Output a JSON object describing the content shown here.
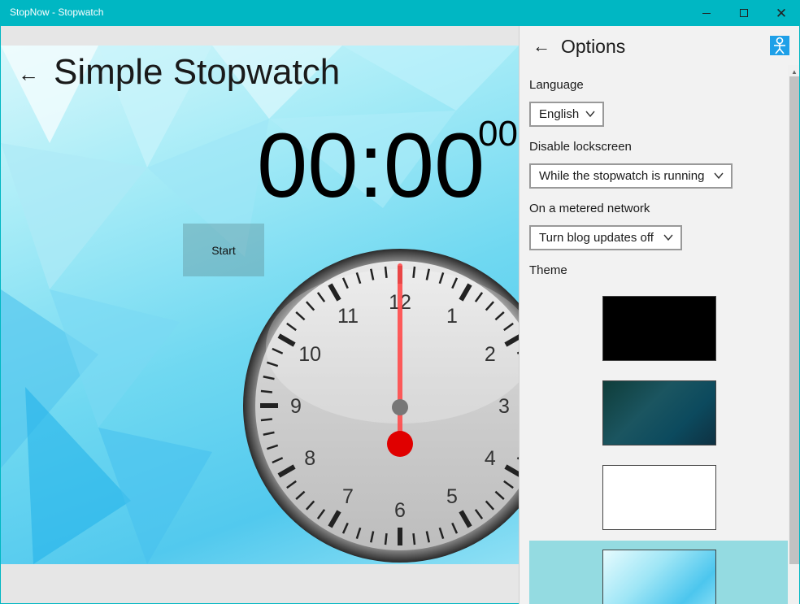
{
  "window": {
    "title": "StopNow - Stopwatch"
  },
  "main": {
    "title": "Simple Stopwatch",
    "time": "00:00",
    "milliseconds": "00",
    "start_label": "Start",
    "clock_numbers": [
      "12",
      "1",
      "2",
      "3",
      "4",
      "5",
      "6",
      "7",
      "8",
      "9",
      "10",
      "11"
    ],
    "hand_color": "#ff3030"
  },
  "options": {
    "heading": "Options",
    "language_label": "Language",
    "language_value": "English",
    "lockscreen_label": "Disable lockscreen",
    "lockscreen_value": "While the stopwatch is running",
    "metered_label": "On a metered network",
    "metered_value": "Turn blog updates off",
    "theme_label": "Theme",
    "themes": [
      {
        "name": "black",
        "color": "#000000"
      },
      {
        "name": "dark-polygon",
        "color": "#1b4a55"
      },
      {
        "name": "white",
        "color": "#ffffff"
      },
      {
        "name": "light-polygon",
        "color": "#7fd9f0"
      }
    ],
    "selected_theme": "light-polygon",
    "accent": "#00b7c3"
  }
}
